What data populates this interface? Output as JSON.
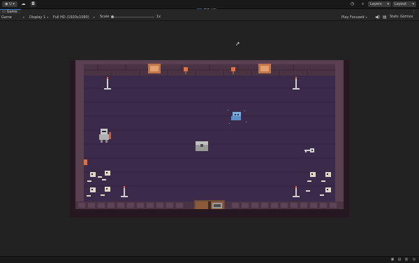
{
  "toolbar": {
    "account_label": "U",
    "layers_label": "Layers",
    "layout_label": "Layout",
    "play_icon": "play-icon",
    "pause_icon": "pause-icon",
    "step_icon": "step-icon"
  },
  "tab": {
    "label": "Game"
  },
  "gamebar": {
    "mode": "Game",
    "display": "Display 1",
    "resolution": "Full HD (1920x1080)",
    "scale_label": "Scale",
    "scale_value": "1x",
    "focus": "Play Focused",
    "stats": "Stats",
    "gizmos": "Gizmos"
  },
  "colors": {
    "accent": "#3d7dd6",
    "dungeon_floor": "#3b2a4a",
    "dungeon_wall": "#5a4250",
    "dungeon_border": "#2a1a22"
  }
}
